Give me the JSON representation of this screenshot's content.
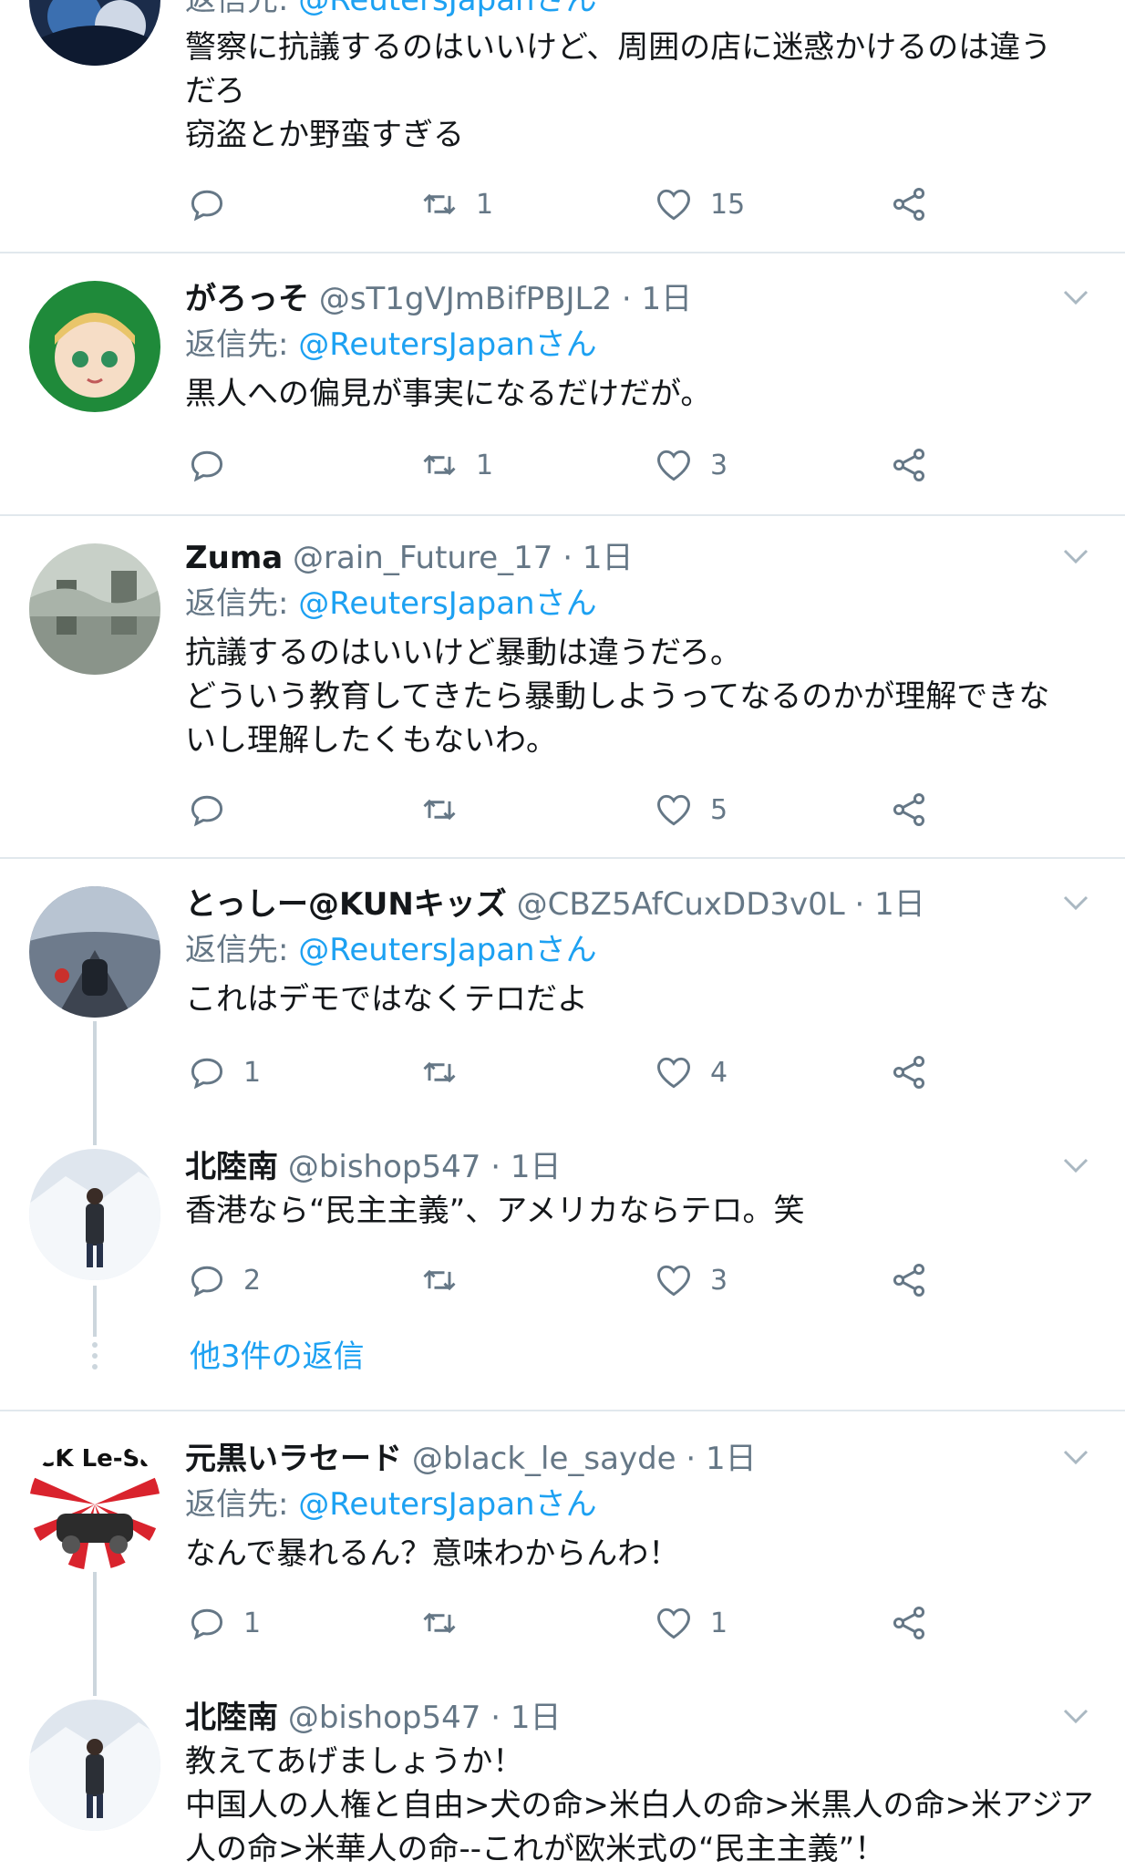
{
  "reply_prefix": "返信先: ",
  "reply_suffix": "さん",
  "top_tweet": {
    "reply_mention": "@ReutersJapan",
    "lines": [
      "警察に抗議するのはいいけど、周囲の店に迷惑かけるのは違う",
      "だろ",
      "窃盗とか野蛮すぎる"
    ],
    "replies": "",
    "retweets": "1",
    "likes": "15"
  },
  "tweets": [
    {
      "name": "がろっそ",
      "handle": "@sT1gVJmBifPBJL2",
      "time": "1日",
      "reply_mention": "@ReutersJapan",
      "lines": [
        "黒人への偏見が事実になるだけだが。"
      ],
      "replies": "",
      "retweets": "1",
      "likes": "3"
    },
    {
      "name": "Zuma",
      "handle": "@rain_Future_17",
      "time": "1日",
      "reply_mention": "@ReutersJapan",
      "lines": [
        "抗議するのはいいけど暴動は違うだろ。",
        "どういう教育してきたら暴動しようってなるのかが理解できな",
        "いし理解したくもないわ。"
      ],
      "replies": "",
      "retweets": "",
      "likes": "5"
    },
    {
      "name": "とっしー@KUNキッズ",
      "handle": "@CBZ5AfCuxDD3v0L",
      "time": "1日",
      "reply_mention": "@ReutersJapan",
      "lines": [
        "これはデモではなくテロだよ"
      ],
      "replies": "1",
      "retweets": "",
      "likes": "4"
    },
    {
      "name": "北陸南",
      "handle": "@bishop547",
      "time": "1日",
      "lines": [
        "香港なら“民主主義”、アメリカならテロ。笑"
      ],
      "replies": "2",
      "retweets": "",
      "likes": "3"
    },
    {
      "name": "元黒いラセード",
      "handle": "@black_le_sayde",
      "time": "1日",
      "reply_mention": "@ReutersJapan",
      "lines": [
        "なんで暴れるん？意味わからんわ！"
      ],
      "replies": "1",
      "retweets": "",
      "likes": "1"
    },
    {
      "name": "北陸南",
      "handle": "@bishop547",
      "time": "1日",
      "lines": [
        "教えてあげましょうか！",
        "中国人の人権と自由>犬の命>米白人の命>米黒人の命>米アジア",
        "人の命>米華人の命--これが欧米式の“民主主義”！"
      ]
    }
  ],
  "more_replies_label": "他3件の返信",
  "avatar_logo_text": "BLACK Le-Sayde",
  "colors": {
    "link": "#1da1f2",
    "meta": "#657786",
    "divider": "#e1e8ed",
    "thread": "#ccd6dd"
  },
  "icons": [
    "reply-icon",
    "retweet-icon",
    "like-icon",
    "share-icon",
    "chevron-down-icon"
  ]
}
